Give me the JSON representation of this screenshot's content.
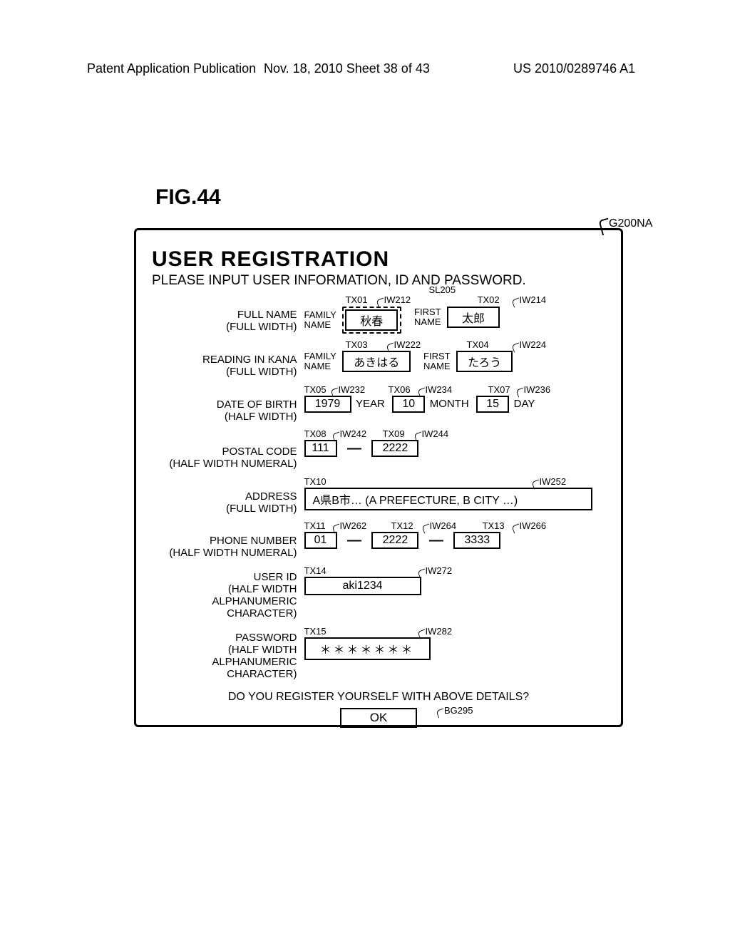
{
  "header": {
    "left": "Patent Application Publication",
    "middle": "Nov. 18, 2010  Sheet 38 of 43",
    "right": "US 2010/0289746 A1"
  },
  "figure_label": "FIG.44",
  "panel_callout": "G200NA",
  "title": "USER REGISTRATION",
  "subtitle": "PLEASE INPUT USER INFORMATION, ID AND PASSWORD.",
  "confirm_text": "DO YOU REGISTER YOURSELF WITH ABOVE DETAILS?",
  "ok_label": "OK",
  "ok_callout": "BG295",
  "rows": {
    "fullname": {
      "label_l1": "FULL NAME",
      "label_l2": "(FULL WIDTH)",
      "family_mini_l1": "FAMILY",
      "family_mini_l2": "NAME",
      "first_mini_l1": "FIRST",
      "first_mini_l2": "NAME",
      "family_val": "秋春",
      "first_val": "太郎",
      "sl": "SL205",
      "tx_family": "TX01",
      "iw_family": "IW212",
      "tx_first": "TX02",
      "iw_first": "IW214"
    },
    "kana": {
      "label_l1": "READING IN KANA",
      "label_l2": "(FULL WIDTH)",
      "family_mini_l1": "FAMILY",
      "family_mini_l2": "NAME",
      "first_mini_l1": "FIRST",
      "first_mini_l2": "NAME",
      "family_val": "あきはる",
      "first_val": "たろう",
      "tx_family": "TX03",
      "iw_family": "IW222",
      "tx_first": "TX04",
      "iw_first": "IW224"
    },
    "dob": {
      "label_l1": "DATE OF BIRTH",
      "label_l2": "(HALF WIDTH)",
      "year_val": "1979",
      "month_val": "10",
      "day_val": "15",
      "year_unit": "YEAR",
      "month_unit": "MONTH",
      "day_unit": "DAY",
      "tx_year": "TX05",
      "iw_year": "IW232",
      "tx_month": "TX06",
      "iw_month": "IW234",
      "tx_day": "TX07",
      "iw_day": "IW236"
    },
    "postal": {
      "label_l1": "POSTAL CODE",
      "label_l2": "(HALF WIDTH NUMERAL)",
      "p1": "111",
      "p2": "2222",
      "tx1": "TX08",
      "iw1": "IW242",
      "tx2": "TX09",
      "iw2": "IW244"
    },
    "address": {
      "label_l1": "ADDRESS",
      "label_l2": "(FULL WIDTH)",
      "val": "A県B市… (A PREFECTURE, B CITY …)",
      "tx": "TX10",
      "iw": "IW252"
    },
    "phone": {
      "label_l1": "PHONE NUMBER",
      "label_l2": "(HALF WIDTH NUMERAL)",
      "p1": "01",
      "p2": "2222",
      "p3": "3333",
      "tx1": "TX11",
      "iw1": "IW262",
      "tx2": "TX12",
      "iw2": "IW264",
      "tx3": "TX13",
      "iw3": "IW266"
    },
    "userid": {
      "label_l1": "USER ID",
      "label_l2": "(HALF WIDTH ALPHANUMERIC",
      "label_l3": "CHARACTER)",
      "val": "aki1234",
      "tx": "TX14",
      "iw": "IW272"
    },
    "password": {
      "label_l1": "PASSWORD",
      "label_l2": "(HALF WIDTH ALPHANUMERIC",
      "label_l3": "CHARACTER)",
      "val": "＊＊＊＊＊＊＊",
      "tx": "TX15",
      "iw": "IW282"
    }
  }
}
